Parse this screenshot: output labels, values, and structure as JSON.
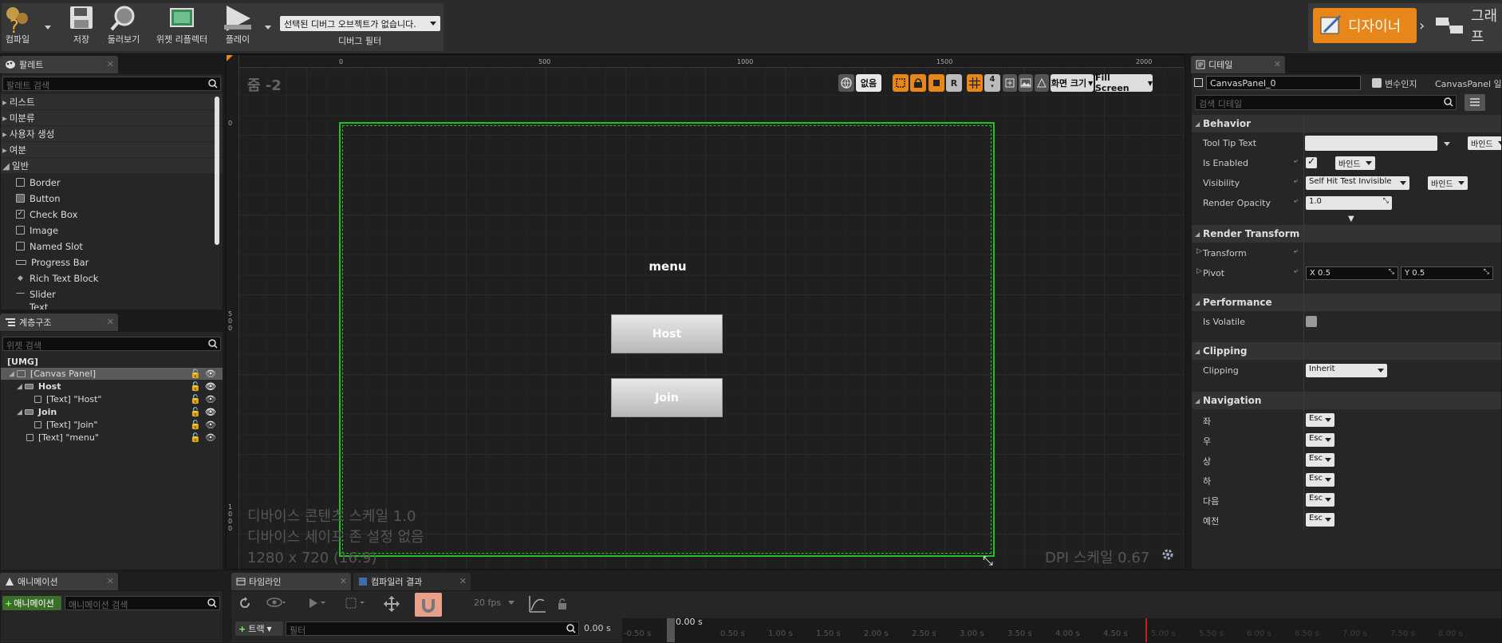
{
  "toolbar": {
    "compile": "컴파일",
    "save": "저장",
    "browse": "둘러보기",
    "widget_reflector": "위젯 리플렉터",
    "play": "플레이",
    "debug_object": "선택된 디버그 오브젝트가 없습니다.",
    "debug_filter": "디버그 필터",
    "designer": "디자이너",
    "graph": "그래프"
  },
  "palette": {
    "tab": "팔레트",
    "search_placeholder": "팔레트 검색",
    "categories": [
      "리스트",
      "미분류",
      "사용자 생성",
      "여분",
      "일반"
    ],
    "items": [
      "Border",
      "Button",
      "Check Box",
      "Image",
      "Named Slot",
      "Progress Bar",
      "Rich Text Block",
      "Slider",
      "Text"
    ]
  },
  "hierarchy": {
    "tab": "계층구조",
    "search_placeholder": "위젯 검색",
    "rows": [
      "[UMG]",
      "[Canvas Panel]",
      "Host",
      "[Text] \"Host\"",
      "Join",
      "[Text] \"Join\"",
      "[Text] \"menu\""
    ]
  },
  "designer": {
    "zoom": "줌 -2",
    "ruler_top": [
      "0",
      "500",
      "1000",
      "1500",
      "2000"
    ],
    "ruler_left": [
      "0",
      "500",
      "1000"
    ],
    "btn_none": "없음",
    "btn_r": "R",
    "btn_4": "4",
    "screen_size": "화면 크기",
    "fill_screen": "Fill Screen",
    "menu_text": "menu",
    "host_btn": "Host",
    "join_btn": "Join",
    "info_line1": "디바이스 콘텐츠 스케일 1.0",
    "info_line2": "디바이스 세이프 존 설정 없음",
    "info_line3": "1280 x 720 (16:9)",
    "dpi": "DPI 스케일 0.67"
  },
  "details": {
    "tab": "디테일",
    "name": "CanvasPanel_0",
    "is_variable": "변수인지",
    "class_name": "CanvasPanel 일",
    "search_placeholder": "검색 디테일",
    "sections": {
      "behavior": "Behavior",
      "render_transform": "Render Transform",
      "performance": "Performance",
      "clipping": "Clipping",
      "navigation": "Navigation"
    },
    "tooltip_text": "Tool Tip Text",
    "is_enabled": "Is Enabled",
    "visibility": "Visibility",
    "visibility_value": "Self Hit Test Invisible",
    "render_opacity": "Render Opacity",
    "render_opacity_value": "1.0",
    "bind": "바인드",
    "transform": "Transform",
    "pivot": "Pivot",
    "pivot_x": "X  0.5",
    "pivot_y": "Y  0.5",
    "is_volatile": "Is Volatile",
    "clipping": "Clipping",
    "clipping_value": "Inherit",
    "nav": [
      "좌",
      "우",
      "상",
      "하",
      "다음",
      "예전"
    ],
    "nav_value": "Esc"
  },
  "animation": {
    "tab": "애니메이션",
    "add_btn": "애니메이션",
    "search_placeholder": "애니메이션 검색"
  },
  "timeline": {
    "tab1": "타임라인",
    "tab2": "컴파일러 결과",
    "fps": "20 fps",
    "track_btn": "트랙",
    "filter_placeholder": "필터",
    "time_left": "0.00 s",
    "time_marker": "0.00 s",
    "ticks": [
      "-0.50 s",
      "0.50 s",
      "1.00 s",
      "1.50 s",
      "2.00 s",
      "2.50 s",
      "3.00 s",
      "3.50 s",
      "4.00 s",
      "4.50 s",
      "5.00 s",
      "5.50 s",
      "6.00 s",
      "6.50 s",
      "7.00 s",
      "7.50 s",
      "8.00 s"
    ]
  },
  "colors": {
    "accent": "#e8861a",
    "selection": "#22c022",
    "panel": "#262626"
  }
}
